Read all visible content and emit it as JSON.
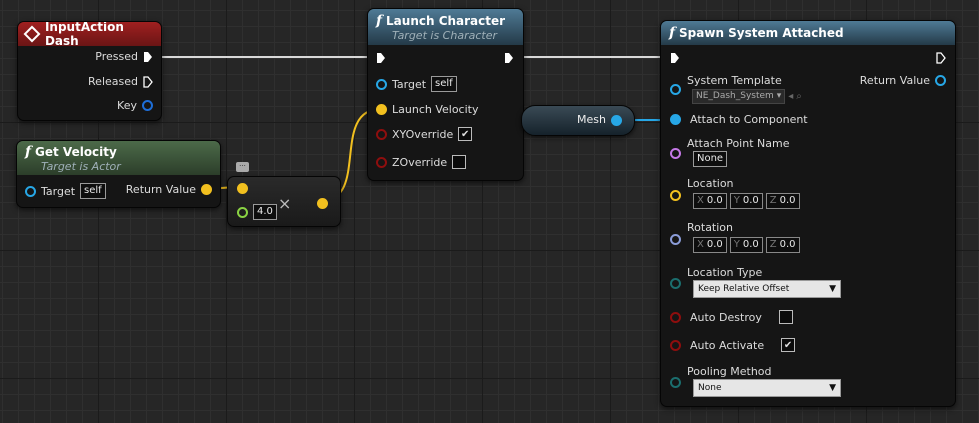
{
  "colors": {
    "exec": "#ffffff",
    "object": "#27a7e6",
    "vector": "#f2c01f",
    "bool": "#8e0e0e",
    "name": "#c478e6",
    "rotator": "#8b9cd8",
    "enum": "#1b6e6e",
    "float": "#8ad343"
  },
  "input_action": {
    "title": "InputAction Dash",
    "pressed": "Pressed",
    "released": "Released",
    "key": "Key"
  },
  "get_velocity": {
    "title": "Get Velocity",
    "subtitle": "Target is Actor",
    "target": "Target",
    "target_value": "self",
    "return_value": "Return Value"
  },
  "multiply": {
    "value": "4.0"
  },
  "launch": {
    "title": "Launch Character",
    "subtitle": "Target is Character",
    "target": "Target",
    "target_value": "self",
    "velocity": "Launch Velocity",
    "xy": "XYOverride",
    "z": "ZOverride"
  },
  "mesh": {
    "label": "Mesh"
  },
  "spawn": {
    "title": "Spawn System Attached",
    "system_template": "System Template",
    "system_template_value": "NE_Dash_System",
    "return_value": "Return Value",
    "attach_component": "Attach to Component",
    "attach_point": "Attach Point Name",
    "attach_point_value": "None",
    "location": "Location",
    "location_values": [
      "0.0",
      "0.0",
      "0.0"
    ],
    "rotation": "Rotation",
    "rotation_values": [
      "0.0",
      "0.0",
      "0.0"
    ],
    "axes": [
      "X",
      "Y",
      "Z"
    ],
    "location_type": "Location Type",
    "location_type_value": "Keep Relative Offset",
    "auto_destroy": "Auto Destroy",
    "auto_activate": "Auto Activate",
    "pooling": "Pooling Method",
    "pooling_value": "None"
  }
}
